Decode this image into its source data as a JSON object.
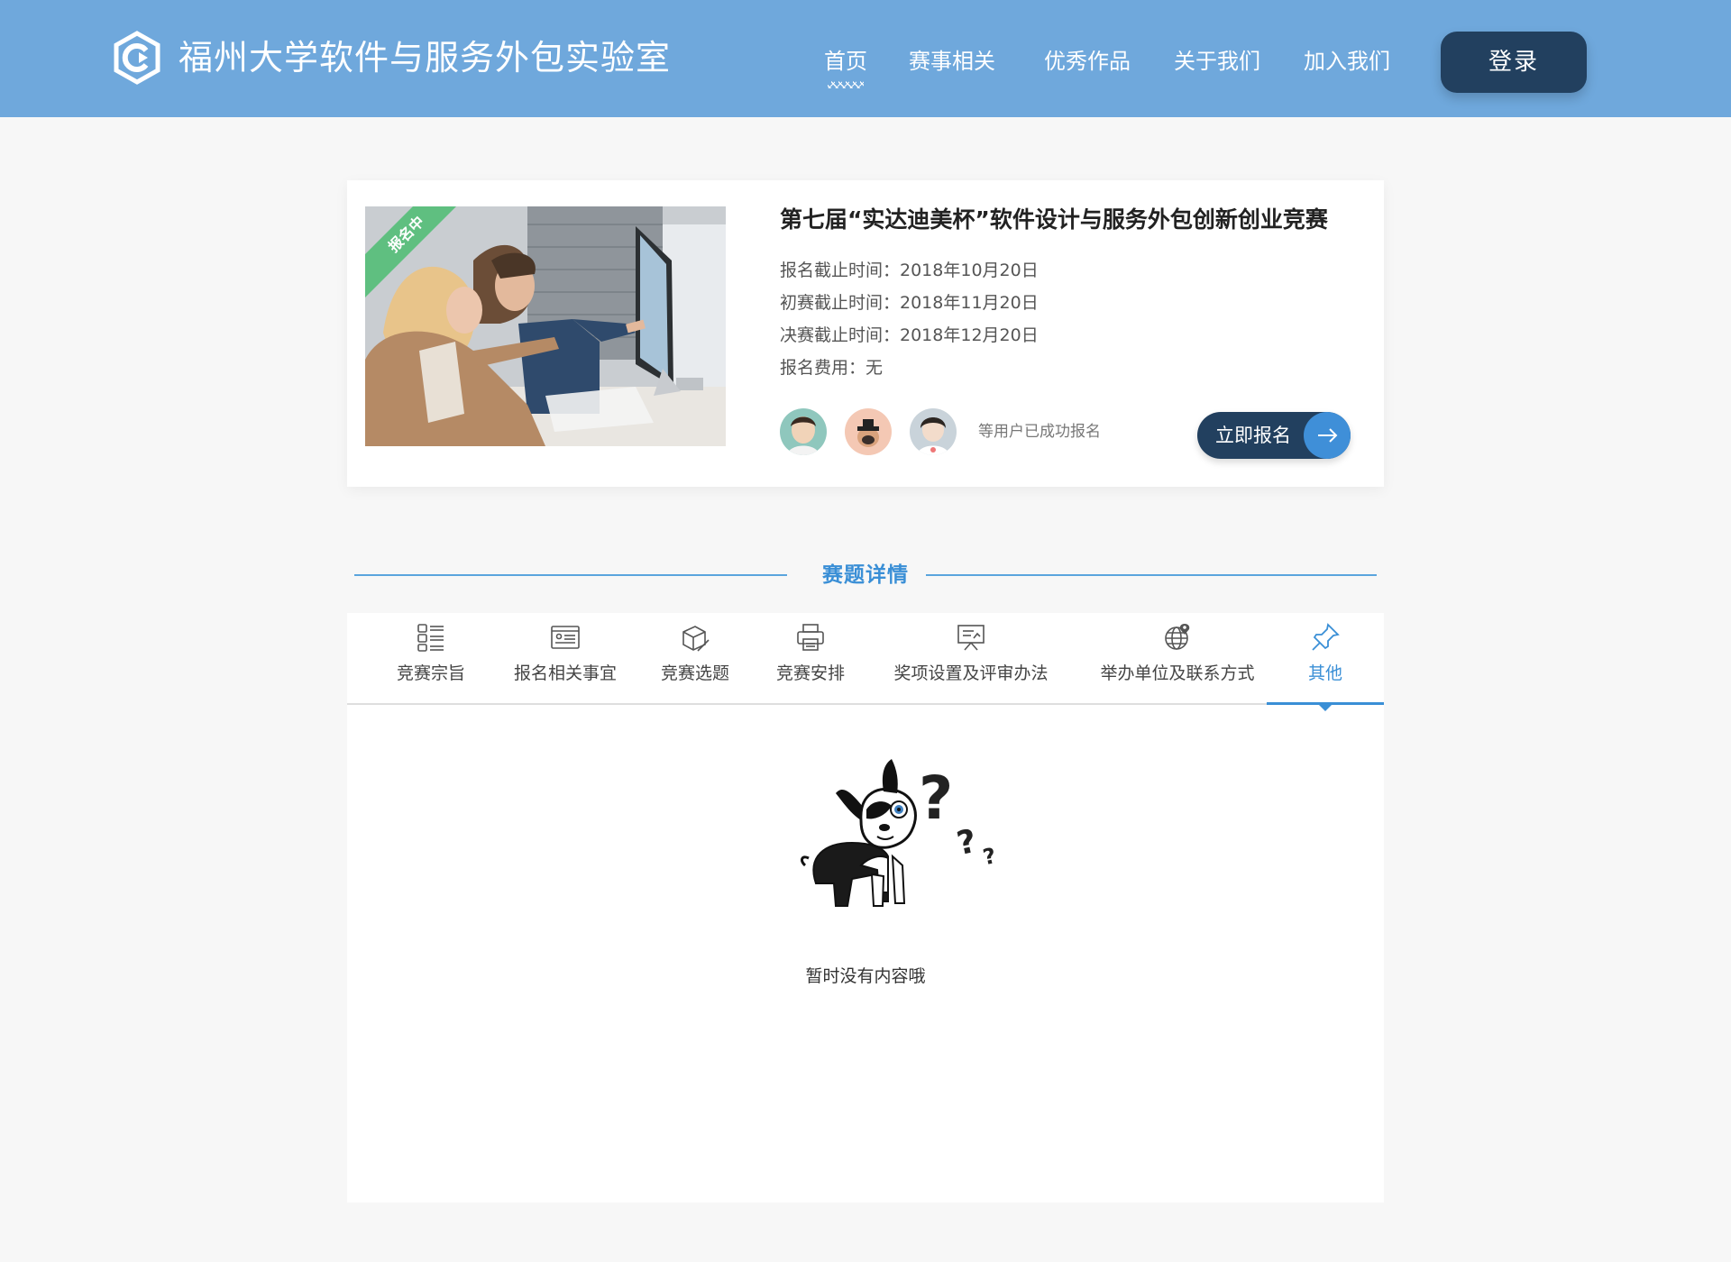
{
  "header": {
    "site_title": "福州大学软件与服务外包实验室",
    "nav": [
      {
        "label": "首页",
        "active": true
      },
      {
        "label": "赛事相关",
        "active": false
      },
      {
        "label": "优秀作品",
        "active": false
      },
      {
        "label": "关于我们",
        "active": false
      },
      {
        "label": "加入我们",
        "active": false
      }
    ],
    "login_label": "登录"
  },
  "competition": {
    "ribbon": "报名中",
    "title": "第七届“实达迪美杯”软件设计与服务外包创新创业竞赛",
    "info": [
      "报名截止时间：2018年10月20日",
      "初赛截止时间：2018年11月20日",
      "决赛截止时间：2018年12月20日",
      "报名费用：无"
    ],
    "registered_note": "等用户已成功报名",
    "register_label": "立即报名"
  },
  "section": {
    "title": "赛题详情"
  },
  "tabs": [
    {
      "label": "竞赛宗旨",
      "icon": "list-grid-icon",
      "active": false
    },
    {
      "label": "报名相关事宜",
      "icon": "id-card-icon",
      "active": false
    },
    {
      "label": "竞赛选题",
      "icon": "box-pencil-icon",
      "active": false
    },
    {
      "label": "竞赛安排",
      "icon": "printer-icon",
      "active": false
    },
    {
      "label": "奖项设置及评审办法",
      "icon": "presentation-board-icon",
      "active": false
    },
    {
      "label": "举办单位及联系方式",
      "icon": "globe-pin-icon",
      "active": false
    },
    {
      "label": "其他",
      "icon": "pin-icon",
      "active": true
    }
  ],
  "empty_state": {
    "text": "暂时没有内容哦"
  },
  "colors": {
    "header_bg": "#6fa8dc",
    "dark_navy": "#22405f",
    "accent_blue": "#3a8fd6",
    "ribbon_green": "#5fbf80"
  }
}
